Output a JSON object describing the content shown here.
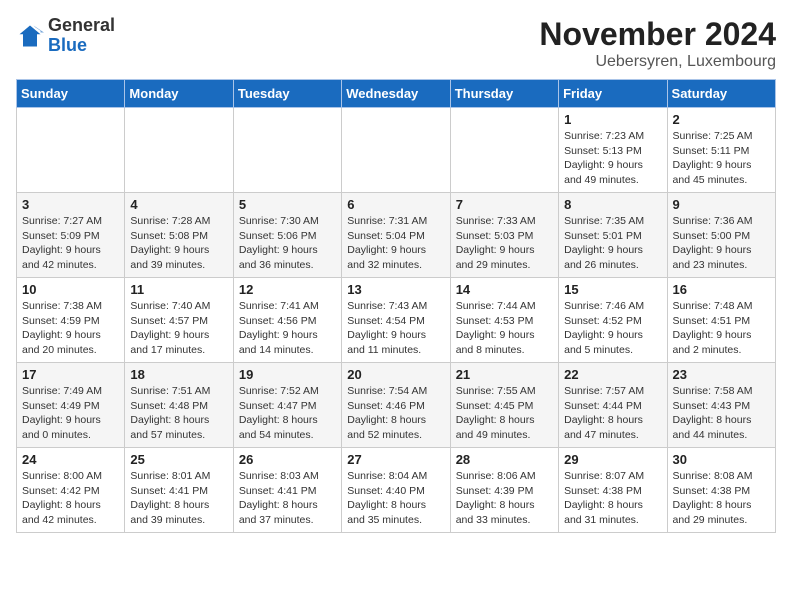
{
  "header": {
    "logo_general": "General",
    "logo_blue": "Blue",
    "month_title": "November 2024",
    "subtitle": "Uebersyren, Luxembourg"
  },
  "days_of_week": [
    "Sunday",
    "Monday",
    "Tuesday",
    "Wednesday",
    "Thursday",
    "Friday",
    "Saturday"
  ],
  "weeks": [
    [
      {
        "day": "",
        "info": ""
      },
      {
        "day": "",
        "info": ""
      },
      {
        "day": "",
        "info": ""
      },
      {
        "day": "",
        "info": ""
      },
      {
        "day": "",
        "info": ""
      },
      {
        "day": "1",
        "info": "Sunrise: 7:23 AM\nSunset: 5:13 PM\nDaylight: 9 hours and 49 minutes."
      },
      {
        "day": "2",
        "info": "Sunrise: 7:25 AM\nSunset: 5:11 PM\nDaylight: 9 hours and 45 minutes."
      }
    ],
    [
      {
        "day": "3",
        "info": "Sunrise: 7:27 AM\nSunset: 5:09 PM\nDaylight: 9 hours and 42 minutes."
      },
      {
        "day": "4",
        "info": "Sunrise: 7:28 AM\nSunset: 5:08 PM\nDaylight: 9 hours and 39 minutes."
      },
      {
        "day": "5",
        "info": "Sunrise: 7:30 AM\nSunset: 5:06 PM\nDaylight: 9 hours and 36 minutes."
      },
      {
        "day": "6",
        "info": "Sunrise: 7:31 AM\nSunset: 5:04 PM\nDaylight: 9 hours and 32 minutes."
      },
      {
        "day": "7",
        "info": "Sunrise: 7:33 AM\nSunset: 5:03 PM\nDaylight: 9 hours and 29 minutes."
      },
      {
        "day": "8",
        "info": "Sunrise: 7:35 AM\nSunset: 5:01 PM\nDaylight: 9 hours and 26 minutes."
      },
      {
        "day": "9",
        "info": "Sunrise: 7:36 AM\nSunset: 5:00 PM\nDaylight: 9 hours and 23 minutes."
      }
    ],
    [
      {
        "day": "10",
        "info": "Sunrise: 7:38 AM\nSunset: 4:59 PM\nDaylight: 9 hours and 20 minutes."
      },
      {
        "day": "11",
        "info": "Sunrise: 7:40 AM\nSunset: 4:57 PM\nDaylight: 9 hours and 17 minutes."
      },
      {
        "day": "12",
        "info": "Sunrise: 7:41 AM\nSunset: 4:56 PM\nDaylight: 9 hours and 14 minutes."
      },
      {
        "day": "13",
        "info": "Sunrise: 7:43 AM\nSunset: 4:54 PM\nDaylight: 9 hours and 11 minutes."
      },
      {
        "day": "14",
        "info": "Sunrise: 7:44 AM\nSunset: 4:53 PM\nDaylight: 9 hours and 8 minutes."
      },
      {
        "day": "15",
        "info": "Sunrise: 7:46 AM\nSunset: 4:52 PM\nDaylight: 9 hours and 5 minutes."
      },
      {
        "day": "16",
        "info": "Sunrise: 7:48 AM\nSunset: 4:51 PM\nDaylight: 9 hours and 2 minutes."
      }
    ],
    [
      {
        "day": "17",
        "info": "Sunrise: 7:49 AM\nSunset: 4:49 PM\nDaylight: 9 hours and 0 minutes."
      },
      {
        "day": "18",
        "info": "Sunrise: 7:51 AM\nSunset: 4:48 PM\nDaylight: 8 hours and 57 minutes."
      },
      {
        "day": "19",
        "info": "Sunrise: 7:52 AM\nSunset: 4:47 PM\nDaylight: 8 hours and 54 minutes."
      },
      {
        "day": "20",
        "info": "Sunrise: 7:54 AM\nSunset: 4:46 PM\nDaylight: 8 hours and 52 minutes."
      },
      {
        "day": "21",
        "info": "Sunrise: 7:55 AM\nSunset: 4:45 PM\nDaylight: 8 hours and 49 minutes."
      },
      {
        "day": "22",
        "info": "Sunrise: 7:57 AM\nSunset: 4:44 PM\nDaylight: 8 hours and 47 minutes."
      },
      {
        "day": "23",
        "info": "Sunrise: 7:58 AM\nSunset: 4:43 PM\nDaylight: 8 hours and 44 minutes."
      }
    ],
    [
      {
        "day": "24",
        "info": "Sunrise: 8:00 AM\nSunset: 4:42 PM\nDaylight: 8 hours and 42 minutes."
      },
      {
        "day": "25",
        "info": "Sunrise: 8:01 AM\nSunset: 4:41 PM\nDaylight: 8 hours and 39 minutes."
      },
      {
        "day": "26",
        "info": "Sunrise: 8:03 AM\nSunset: 4:41 PM\nDaylight: 8 hours and 37 minutes."
      },
      {
        "day": "27",
        "info": "Sunrise: 8:04 AM\nSunset: 4:40 PM\nDaylight: 8 hours and 35 minutes."
      },
      {
        "day": "28",
        "info": "Sunrise: 8:06 AM\nSunset: 4:39 PM\nDaylight: 8 hours and 33 minutes."
      },
      {
        "day": "29",
        "info": "Sunrise: 8:07 AM\nSunset: 4:38 PM\nDaylight: 8 hours and 31 minutes."
      },
      {
        "day": "30",
        "info": "Sunrise: 8:08 AM\nSunset: 4:38 PM\nDaylight: 8 hours and 29 minutes."
      }
    ]
  ]
}
